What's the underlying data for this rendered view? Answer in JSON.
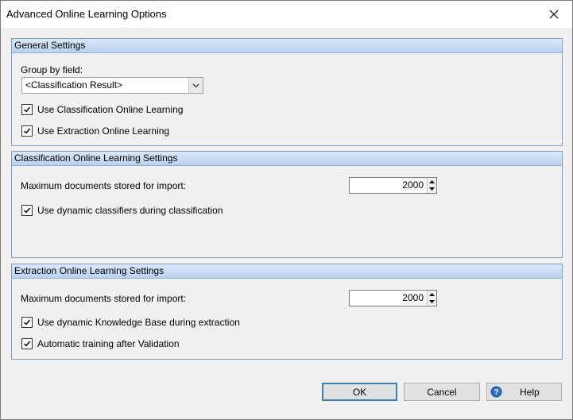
{
  "window": {
    "title": "Advanced Online Learning Options"
  },
  "general": {
    "header": "General Settings",
    "group_by_label": "Group by field:",
    "group_by_value": "<Classification Result>",
    "use_classification": "Use Classification Online Learning",
    "use_extraction": "Use Extraction Online Learning"
  },
  "classification": {
    "header": "Classification Online Learning Settings",
    "max_docs_label": "Maximum documents stored for import:",
    "max_docs_value": "2000",
    "dynamic_label": "Use dynamic classifiers during classification"
  },
  "extraction": {
    "header": "Extraction Online Learning Settings",
    "max_docs_label": "Maximum documents stored for import:",
    "max_docs_value": "2000",
    "dynamic_label": "Use dynamic Knowledge Base during extraction",
    "auto_training_label": "Automatic training after Validation"
  },
  "buttons": {
    "ok": "OK",
    "cancel": "Cancel",
    "help": "Help"
  },
  "icons": {
    "close": "close-icon",
    "dropdown": "chevron-down-icon",
    "check": "checkmark-icon",
    "help": "help-icon"
  },
  "colors": {
    "group_header_top": "#dbe8f8",
    "group_header_bottom": "#b9d1ef",
    "default_button_border": "#3c7fb1"
  }
}
